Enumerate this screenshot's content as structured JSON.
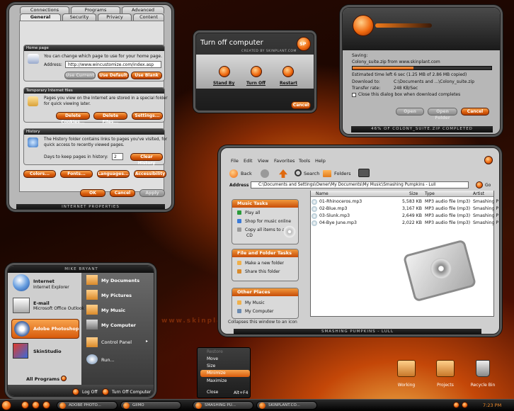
{
  "ie": {
    "tabs_row1": [
      "Connections",
      "Programs",
      "Advanced"
    ],
    "tabs_row2": [
      "General",
      "Security",
      "Privacy",
      "Content"
    ],
    "home": {
      "title": "Home page",
      "desc": "You can change which page to use for your home page.",
      "addr_label": "Address:",
      "addr_value": "http://www.wincustomize.com/index.asp",
      "btns": [
        "Use Current",
        "Use Default",
        "Use Blank"
      ]
    },
    "temp": {
      "title": "Temporary Internet files",
      "desc1": "Pages you view on the Internet are stored in a special folder",
      "desc2": "for quick viewing later.",
      "btns": [
        "Delete Cookies...",
        "Delete Files...",
        "Settings..."
      ]
    },
    "hist": {
      "title": "History",
      "desc1": "The History folder contains links to pages you've visited, for",
      "desc2": "quick access to recently viewed pages.",
      "days_label": "Days to keep pages in history:",
      "days_value": "2",
      "clear": "Clear History"
    },
    "bottom_btns": [
      "Colors...",
      "Fonts...",
      "Languages...",
      "Accessibility"
    ],
    "ok": "OK",
    "cancel": "Cancel",
    "apply": "Apply",
    "status": "INTERNET PROPERTIES"
  },
  "turnoff": {
    "title": "Turn off computer",
    "logo": "SP",
    "credit": "CREATED BY SKINPLANT.COM",
    "options": [
      "Stand By",
      "Turn Off",
      "Restart"
    ],
    "cancel": "Cancel"
  },
  "download": {
    "saving": "Saving:",
    "file": "Colony_suite.zip from www.skinplant.com",
    "est_label": "Estimated time left 6 sec (1.25 MB of 2.86 MB copied)",
    "dl_label": "Download to:",
    "dl_value": "C:\\Documents and ...\\Colony_suite.zip",
    "rate_label": "Transfer rate:",
    "rate_value": "248 KB/Sec",
    "close_label": "Close this dialog box when download completes",
    "progress": 0.44,
    "btns": [
      "Open",
      "Open Folder",
      "Cancel"
    ],
    "status": "46% OF COLONY_SUITE.ZIP COMPLETED"
  },
  "explorer": {
    "menus": [
      "File",
      "Edit",
      "View",
      "Favorites",
      "Tools",
      "Help"
    ],
    "back": "Back",
    "search": "Search",
    "folders": "Folders",
    "addr_label": "Address",
    "addr_value": "C:\\Documents and Settings\\Owner\\My Documents\\My Music\\Smashing Pumpkins - Lull",
    "go": "Go",
    "music_tasks": {
      "title": "Music Tasks",
      "items": [
        "Play all",
        "Shop for music online",
        "Copy all items to audio",
        "CD"
      ]
    },
    "file_tasks": {
      "title": "File and Folder Tasks",
      "items": [
        "Make a new folder",
        "Share this folder"
      ]
    },
    "places": {
      "title": "Other Places",
      "items": [
        "My Music",
        "My Computer"
      ]
    },
    "cols": [
      "Name",
      "Size",
      "Type",
      "Artist"
    ],
    "rows": [
      {
        "name": "01-Rhinoceros.mp3",
        "size": "5,583 KB",
        "type": "MP3 audio file (mp3)",
        "artist": "Smashing P"
      },
      {
        "name": "02-Blue.mp3",
        "size": "3,167 KB",
        "type": "MP3 audio file (mp3)",
        "artist": "Smashing P"
      },
      {
        "name": "03-Slunk.mp3",
        "size": "2,649 KB",
        "type": "MP3 audio file (mp3)",
        "artist": "Smashing P"
      },
      {
        "name": "04-Bye June.mp3",
        "size": "2,022 KB",
        "type": "MP3 audio file (mp3)",
        "artist": "Smashing P"
      }
    ],
    "statusbar": "Collapses this window to an icon",
    "title": "SMASHING PUMPKINS - LULL"
  },
  "start": {
    "user": "MIKE BRYANT",
    "left": [
      {
        "t": "Internet",
        "s": "Internet Explorer"
      },
      {
        "t": "E-mail",
        "s": "Microsoft Office Outlook"
      },
      {
        "t": "Adobe Photoshop",
        "s": ""
      },
      {
        "t": "SkinStudio",
        "s": ""
      }
    ],
    "all": "All Programs",
    "right": [
      "My Documents",
      "My Pictures",
      "My Music",
      "My Computer",
      "Control Panel",
      "Run..."
    ],
    "logoff": "Log Off",
    "turnoff": "Turn Off Computer"
  },
  "ctxmenu": {
    "items": [
      "Restore",
      "Move",
      "Size",
      "Minimize",
      "Maximize",
      "Close"
    ],
    "shortcut": "Alt+F4"
  },
  "desktop": {
    "icons": [
      "Working",
      "Projects",
      "Recycle Bin"
    ],
    "watermark": "www.skinplant.com"
  },
  "taskbar": {
    "items": [
      "ADOBE PHOTO...",
      "GIIMO",
      "SMASHING PU...",
      "SKINPLANT.CO..."
    ],
    "time": "7:23 PM"
  }
}
